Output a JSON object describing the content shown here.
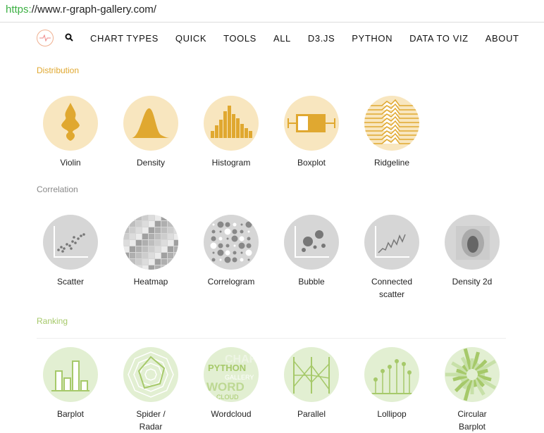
{
  "url": {
    "scheme": "https:",
    "rest": "//www.r-graph-gallery.com/"
  },
  "nav": [
    "CHART TYPES",
    "QUICK",
    "TOOLS",
    "ALL",
    "D3.JS",
    "PYTHON",
    "DATA TO VIZ",
    "ABOUT"
  ],
  "colors": {
    "distribution": "#e0a830",
    "distribution_bg": "#f8e6bf",
    "correlation": "#888888",
    "correlation_bg": "#d6d6d6",
    "ranking": "#a6c96a",
    "ranking_bg": "#e2efd2"
  },
  "sections": [
    {
      "title": "Distribution",
      "items": [
        "Violin",
        "Density",
        "Histogram",
        "Boxplot",
        "Ridgeline"
      ]
    },
    {
      "title": "Correlation",
      "items": [
        "Scatter",
        "Heatmap",
        "Correlogram",
        "Bubble",
        "Connected scatter",
        "Density 2d"
      ]
    },
    {
      "title": "Ranking",
      "items": [
        "Barplot",
        "Spider / Radar",
        "Wordcloud",
        "Parallel",
        "Lollipop",
        "Circular Barplot"
      ]
    }
  ]
}
